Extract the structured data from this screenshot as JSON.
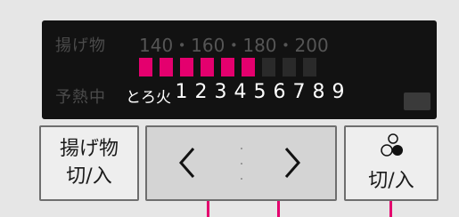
{
  "display": {
    "fry_label": "揚げ物",
    "temperatures": "140・160・180・200",
    "preheat_label": "予熱中",
    "low_fire_label": "とろ火",
    "levels": [
      "1",
      "2",
      "3",
      "4",
      "5",
      "6",
      "7",
      "8",
      "9"
    ],
    "active_segments": 6,
    "total_segments": 9
  },
  "buttons": {
    "fry_toggle_label": "揚げ物\n切/入",
    "left_arrow": "<",
    "right_arrow": ">",
    "power_label": "切/入"
  },
  "colors": {
    "accent": "#e4006e",
    "display_bg": "#121212",
    "panel_bg": "#e6e6e6"
  }
}
